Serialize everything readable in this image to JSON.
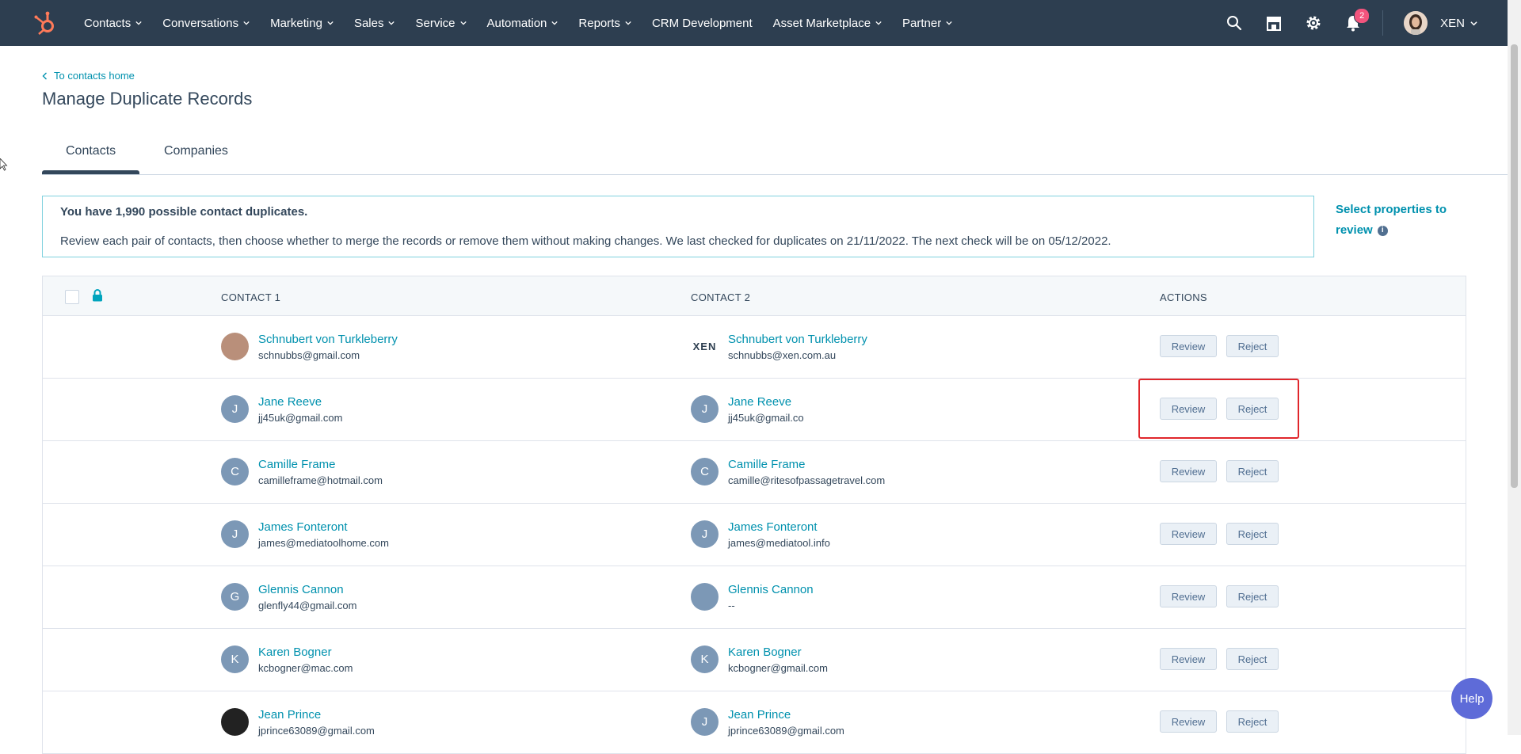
{
  "nav": {
    "items": [
      "Contacts",
      "Conversations",
      "Marketing",
      "Sales",
      "Service",
      "Automation",
      "Reports",
      "CRM Development",
      "Asset Marketplace",
      "Partner"
    ],
    "items_with_dropdown": [
      true,
      true,
      true,
      true,
      true,
      true,
      true,
      false,
      true,
      true
    ],
    "notification_count": "2",
    "user_name": "XEN"
  },
  "header": {
    "back_link": "To contacts home",
    "title": "Manage Duplicate Records"
  },
  "tabs": {
    "contacts": "Contacts",
    "companies": "Companies",
    "active": "Contacts"
  },
  "alert": {
    "title": "You have 1,990 possible contact duplicates.",
    "body": "Review each pair of contacts, then choose whether to merge the records or remove them without making changes. We last checked for duplicates on 21/11/2022. The next check will be on 05/12/2022."
  },
  "select_properties": "Select properties to review",
  "table": {
    "headers": {
      "contact1": "CONTACT 1",
      "contact2": "CONTACT 2",
      "actions": "ACTIONS"
    },
    "review_label": "Review",
    "reject_label": "Reject",
    "rows": [
      {
        "c1_initial": "",
        "c1_name": "Schnubert von Turkleberry",
        "c1_email": "schnubbs@gmail.com",
        "c2_initial": "XEN",
        "c2_name": "Schnubert von Turkleberry",
        "c2_email": "schnubbs@xen.com.au"
      },
      {
        "c1_initial": "J",
        "c1_name": "Jane Reeve",
        "c1_email": "jj45uk@gmail.com",
        "c2_initial": "J",
        "c2_name": "Jane Reeve",
        "c2_email": "jj45uk@gmail.co"
      },
      {
        "c1_initial": "C",
        "c1_name": "Camille Frame",
        "c1_email": "camilleframe@hotmail.com",
        "c2_initial": "C",
        "c2_name": "Camille Frame",
        "c2_email": "camille@ritesofpassagetravel.com"
      },
      {
        "c1_initial": "J",
        "c1_name": "James Fonteront",
        "c1_email": "james@mediatoolhome.com",
        "c2_initial": "J",
        "c2_name": "James Fonteront",
        "c2_email": "james@mediatool.info"
      },
      {
        "c1_initial": "G",
        "c1_name": "Glennis Cannon",
        "c1_email": "glenfly44@gmail.com",
        "c2_initial": "",
        "c2_name": "Glennis Cannon",
        "c2_email": "--"
      },
      {
        "c1_initial": "K",
        "c1_name": "Karen Bogner",
        "c1_email": "kcbogner@mac.com",
        "c2_initial": "K",
        "c2_name": "Karen Bogner",
        "c2_email": "kcbogner@gmail.com"
      },
      {
        "c1_initial": "",
        "c1_name": "Jean Prince",
        "c1_email": "jprince63089@gmail.com",
        "c2_initial": "J",
        "c2_name": "Jean Prince",
        "c2_email": "jprince63089@gmail.com"
      }
    ]
  },
  "help_label": "Help",
  "colors": {
    "nav_bg": "#2d3e50",
    "link": "#0091ae",
    "text": "#33475b",
    "highlight": "#e0262b",
    "help": "#5e6bd8",
    "logo": "#ff7a59"
  }
}
